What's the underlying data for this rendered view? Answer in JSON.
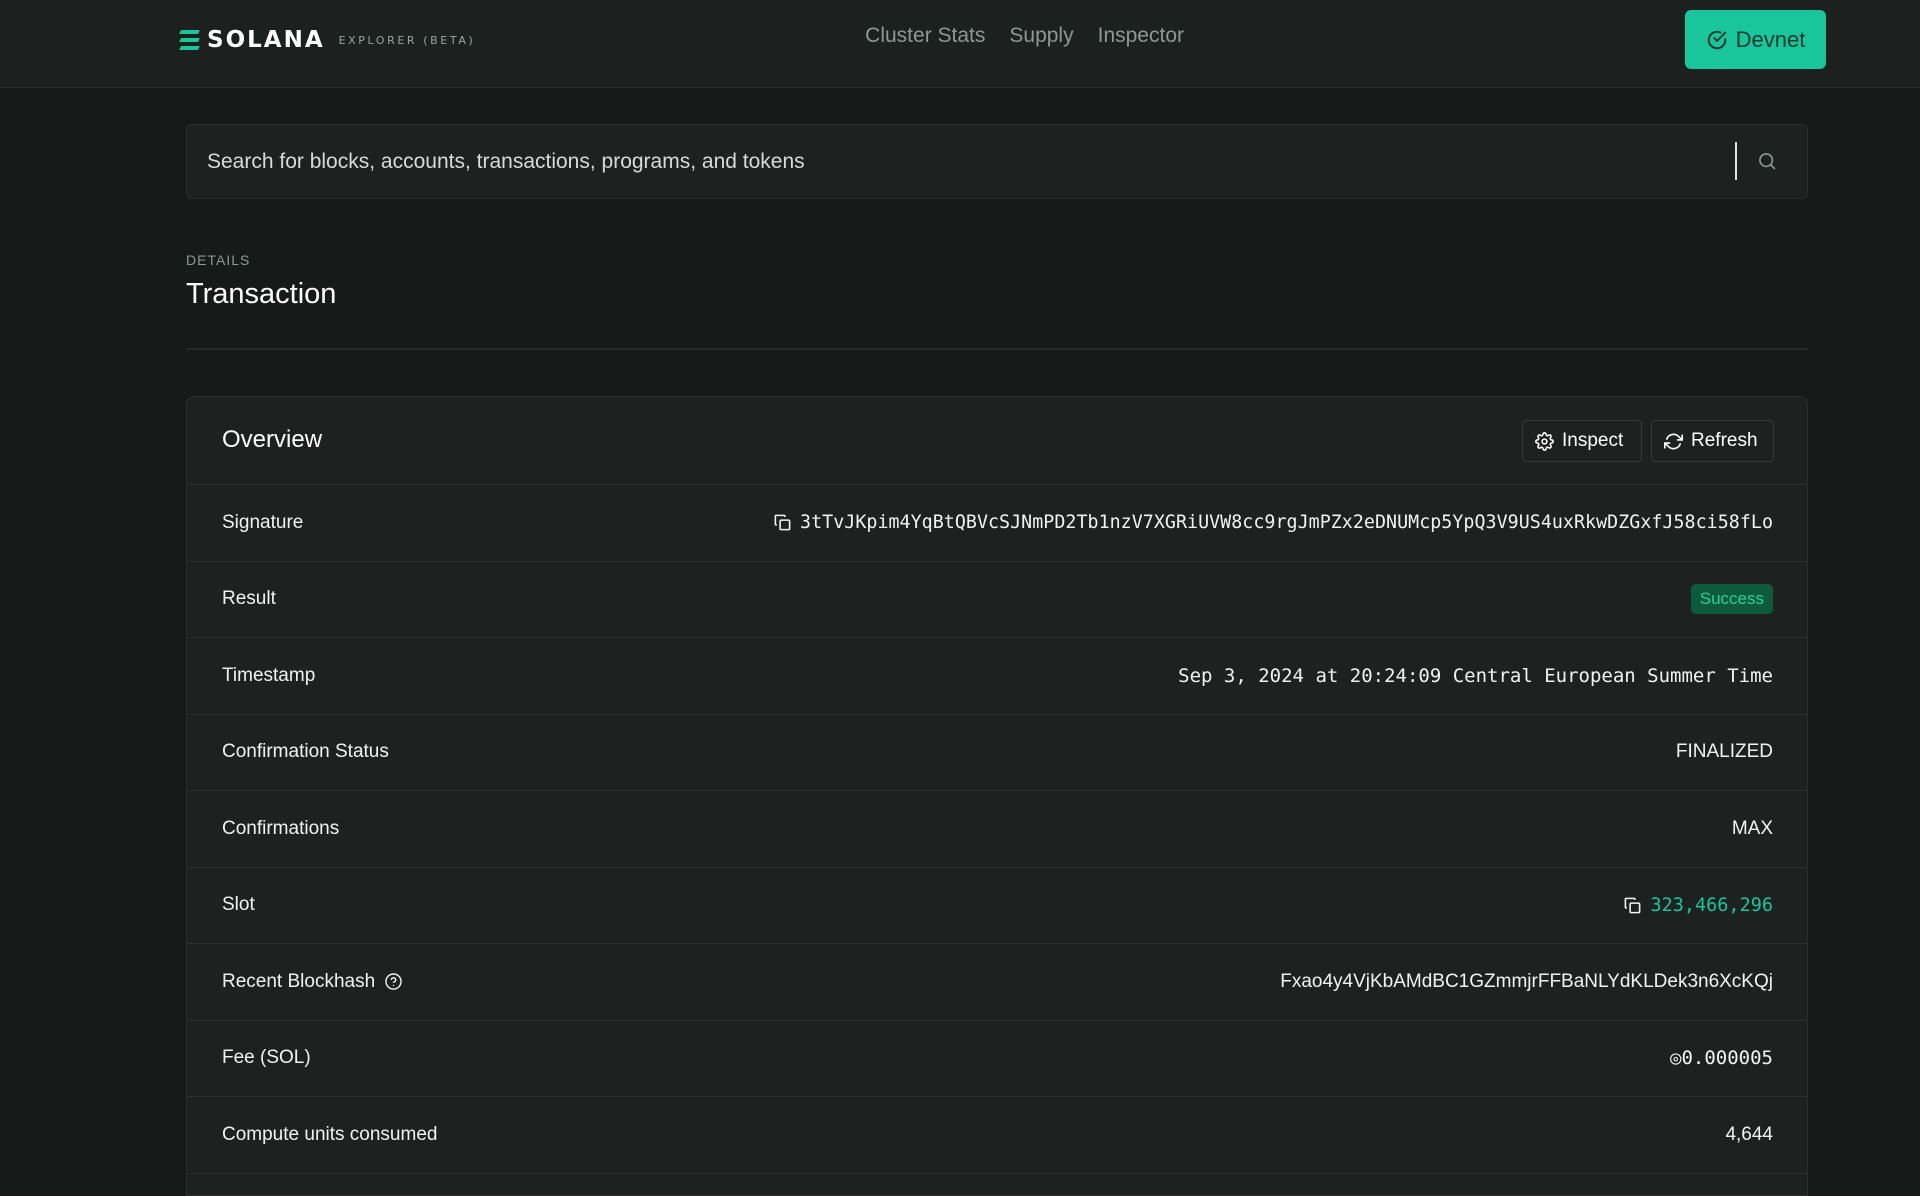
{
  "nav": {
    "brand": "SOLANA",
    "brand_sub": "EXPLORER (BETA)",
    "links": [
      "Cluster Stats",
      "Supply",
      "Inspector"
    ],
    "cluster_label": "Devnet"
  },
  "search": {
    "placeholder": "Search for blocks, accounts, transactions, programs, and tokens"
  },
  "header": {
    "pretitle": "DETAILS",
    "title": "Transaction"
  },
  "overview": {
    "title": "Overview",
    "inspect_label": "Inspect",
    "refresh_label": "Refresh",
    "rows": {
      "signature": {
        "label": "Signature",
        "value": "3tTvJKpim4YqBtQBVcSJNmPD2Tb1nzV7XGRiUVW8cc9rgJmPZx2eDNUMcp5YpQ3V9US4uxRkwDZGxfJ58ci58fLo"
      },
      "result": {
        "label": "Result",
        "value": "Success"
      },
      "timestamp": {
        "label": "Timestamp",
        "value": "Sep 3, 2024 at 20:24:09 Central European Summer Time"
      },
      "confirmation_status": {
        "label": "Confirmation Status",
        "value": "FINALIZED"
      },
      "confirmations": {
        "label": "Confirmations",
        "value": "MAX"
      },
      "slot": {
        "label": "Slot",
        "value": "323,466,296"
      },
      "recent_blockhash": {
        "label": "Recent Blockhash",
        "value": "Fxao4y4VjKbAMdBC1GZmmjrFFBaNLYdKLDek3n6XcKQj"
      },
      "fee": {
        "label": "Fee (SOL)",
        "value": "◎0.000005"
      },
      "compute_units": {
        "label": "Compute units consumed",
        "value": "4,644"
      }
    }
  },
  "colors": {
    "accent": "#19c59b",
    "background": "#161a19",
    "card": "#1d2221",
    "success_bg": "#0e5a3f",
    "success_text": "#26d39a"
  },
  "icons": {
    "cluster": "check-circle-icon",
    "search": "search-icon",
    "inspect": "gear-icon",
    "refresh": "refresh-icon",
    "copy": "copy-icon",
    "help": "help-circle-icon"
  }
}
